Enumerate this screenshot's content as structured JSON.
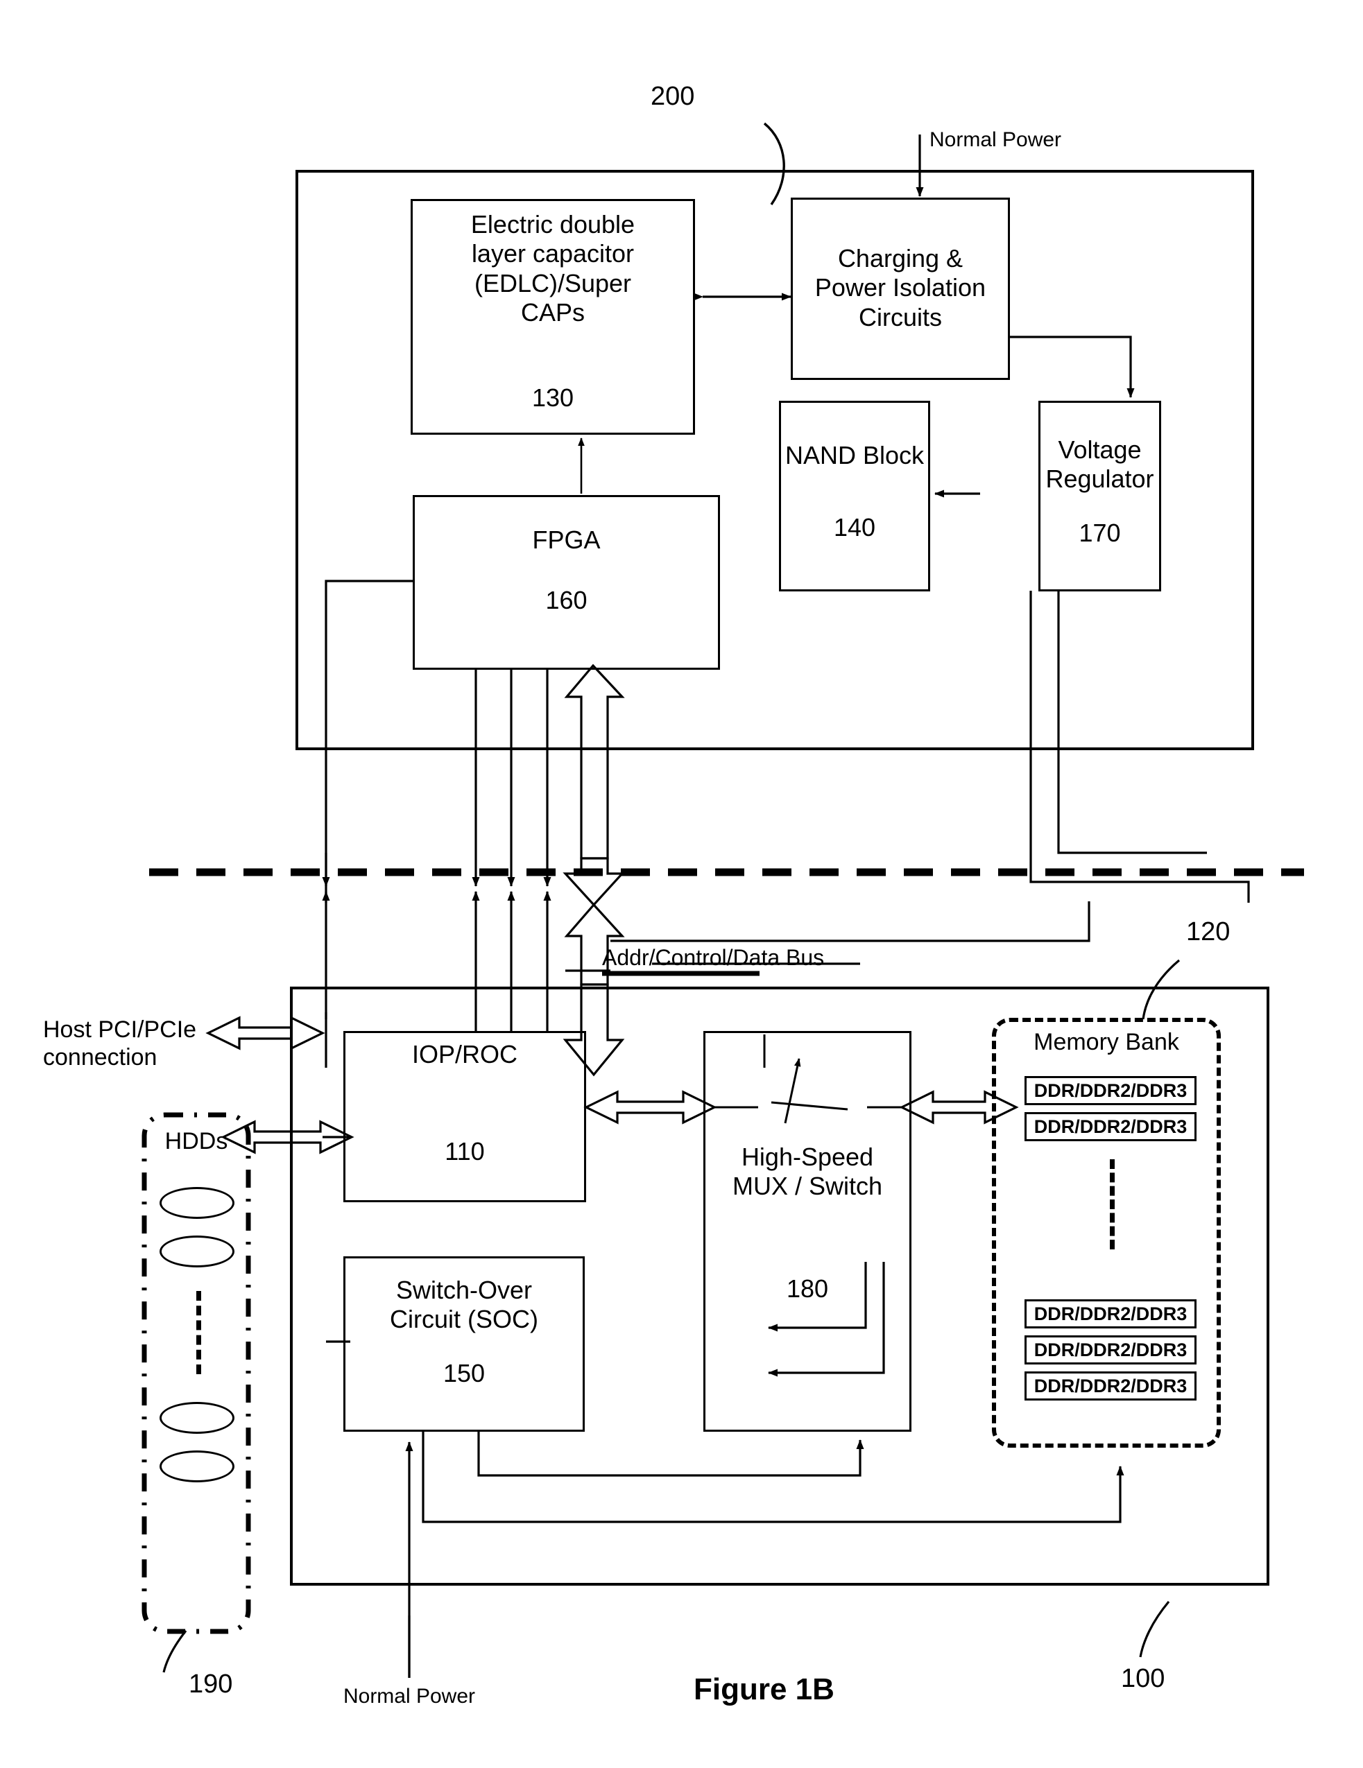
{
  "figure": {
    "caption": "Figure 1B",
    "ref_top_assembly": "200",
    "ref_bottom_assembly": "100",
    "ref_memory_bank": "120",
    "ref_hdds": "190"
  },
  "labels": {
    "normal_power_top": "Normal Power",
    "normal_power_bottom": "Normal Power",
    "bus": "Addr/Control/Data Bus",
    "host_connection": "Host PCI/PCIe\nconnection"
  },
  "blocks": {
    "edlc": {
      "title": "Electric double\nlayer capacitor\n(EDLC)/Super\nCAPs",
      "number": "130"
    },
    "charging": {
      "title": "Charging &\nPower Isolation\nCircuits",
      "number": ""
    },
    "nand": {
      "title": "NAND Block",
      "number": "140"
    },
    "vreg": {
      "title": "Voltage\nRegulator",
      "number": "170"
    },
    "fpga": {
      "title": "FPGA",
      "number": "160"
    },
    "iop": {
      "title": "IOP/ROC",
      "number": "110"
    },
    "soc": {
      "title": "Switch-Over\nCircuit (SOC)",
      "number": "150"
    },
    "mux": {
      "title": "High-Speed\nMUX / Switch",
      "number": "180"
    }
  },
  "memory_bank": {
    "title": "Memory Bank",
    "modules_top": [
      "DDR/DDR2/DDR3",
      "DDR/DDR2/DDR3"
    ],
    "modules_bottom": [
      "DDR/DDR2/DDR3",
      "DDR/DDR2/DDR3",
      "DDR/DDR2/DDR3"
    ]
  },
  "hdds": {
    "title": "HDDs",
    "drive_count_shown": 4
  },
  "colors": {
    "line": "#000000",
    "background": "#ffffff"
  }
}
